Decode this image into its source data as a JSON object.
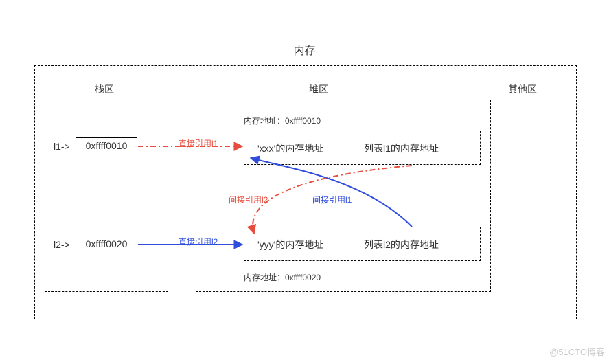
{
  "title": "内存",
  "regions": {
    "stack": "栈区",
    "heap": "堆区",
    "other": "其他区"
  },
  "stack": {
    "l1_label": "l1->",
    "l1_addr": "0xffff0010",
    "l2_label": "l2->",
    "l2_addr": "0xffff0020"
  },
  "heap": {
    "addr_top_label": "内存地址：0xffff0010",
    "addr_bottom_label": "内存地址：0xffff0020",
    "cell_top_left": "'xxx'的内存地址",
    "cell_top_right": "列表l1的内存地址",
    "cell_bottom_left": "'yyy'的内存地址",
    "cell_bottom_right": "列表l2的内存地址"
  },
  "arrows": {
    "direct_l1": "直接引用l1",
    "direct_l2": "直接引用l2",
    "indirect_l1": "间接引用l1",
    "indirect_l2": "间接引用l2"
  },
  "colors": {
    "red": "#e74c3c",
    "blue": "#2f4cdd"
  },
  "watermark": "@51CTO博客"
}
